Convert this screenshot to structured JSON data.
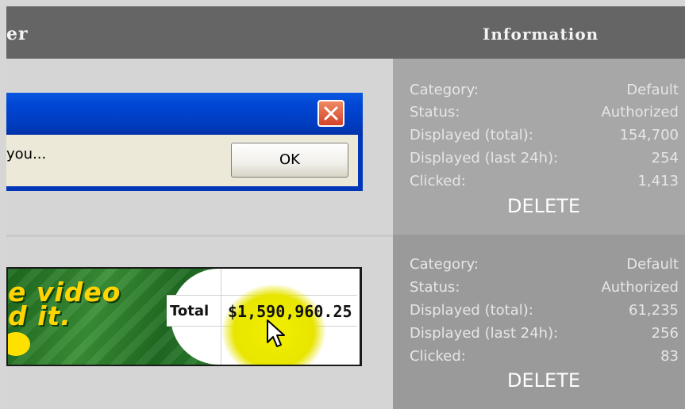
{
  "header": {
    "left_label": "er",
    "right_label": "Information"
  },
  "dialog": {
    "message": "you...",
    "ok_label": "OK"
  },
  "banner": {
    "line1": "e video",
    "line2": "d it.",
    "table_label": "Total",
    "table_value": "$1,590,960.25"
  },
  "panels": [
    {
      "rows": [
        {
          "label": "Category:",
          "value": "Default"
        },
        {
          "label": "Status:",
          "value": "Authorized"
        },
        {
          "label": "Displayed (total):",
          "value": "154,700"
        },
        {
          "label": "Displayed (last 24h):",
          "value": "254"
        },
        {
          "label": "Clicked:",
          "value": "1,413"
        }
      ],
      "delete_label": "DELETE"
    },
    {
      "rows": [
        {
          "label": "Category:",
          "value": "Default"
        },
        {
          "label": "Status:",
          "value": "Authorized"
        },
        {
          "label": "Displayed (total):",
          "value": "61,235"
        },
        {
          "label": "Displayed (last 24h):",
          "value": "256"
        },
        {
          "label": "Clicked:",
          "value": "83"
        }
      ],
      "delete_label": "DELETE"
    }
  ],
  "colors": {
    "header_bg": "#656565",
    "dialog_titlebar": "#0046d4",
    "close_button": "#d3432a",
    "banner_text": "#ffd400",
    "highlight": "#f2ef00"
  },
  "icons": {
    "close": "close-icon",
    "cursor": "mouse-cursor-icon"
  }
}
